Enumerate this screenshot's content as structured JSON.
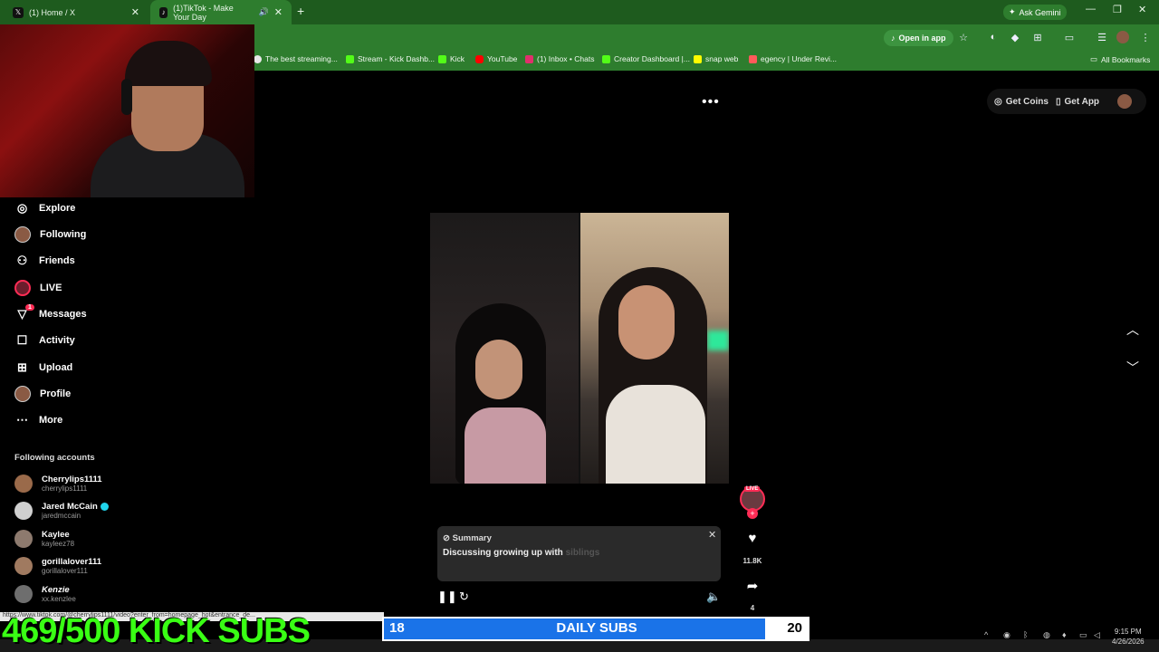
{
  "browser": {
    "tabs": [
      {
        "label": "(1) Home / X",
        "icon": "x-icon"
      },
      {
        "label": "(1)TikTok - Make Your Day",
        "icon": "tiktok-icon"
      }
    ],
    "ask_gemini": "Ask Gemini",
    "open_in_app": "Open in app",
    "bookmarks": [
      {
        "label": "The best streaming...",
        "color": "#e8e8e8"
      },
      {
        "label": "Stream - Kick Dashb...",
        "color": "#53fc18"
      },
      {
        "label": "Kick",
        "color": "#53fc18"
      },
      {
        "label": "YouTube",
        "color": "#ff0000"
      },
      {
        "label": "(1) Inbox • Chats",
        "color": "#e1306c"
      },
      {
        "label": "Creator Dashboard |...",
        "color": "#53fc18"
      },
      {
        "label": "snap web",
        "color": "#fffc00"
      },
      {
        "label": "egency | Under Revi...",
        "color": "#ff5a5a"
      }
    ],
    "all_bookmarks": "All Bookmarks"
  },
  "sidebar": {
    "nav": [
      {
        "label": "Explore",
        "icon": "compass-icon"
      },
      {
        "label": "Following",
        "icon": "following-avatar-icon"
      },
      {
        "label": "Friends",
        "icon": "friends-icon"
      },
      {
        "label": "LIVE",
        "icon": "live-icon"
      },
      {
        "label": "Messages",
        "icon": "messages-icon",
        "badge": "1"
      },
      {
        "label": "Activity",
        "icon": "activity-icon"
      },
      {
        "label": "Upload",
        "icon": "upload-icon"
      },
      {
        "label": "Profile",
        "icon": "profile-avatar-icon"
      },
      {
        "label": "More",
        "icon": "more-icon"
      }
    ],
    "following_label": "Following accounts",
    "accounts": [
      {
        "name": "Cherrylips1111",
        "username": "cherrylips1111",
        "verified": false
      },
      {
        "name": "Jared McCain",
        "username": "jaredmccain",
        "verified": true
      },
      {
        "name": "Kaylee",
        "username": "kayleez78",
        "verified": false
      },
      {
        "name": "gorillalover111",
        "username": "gorillalover111",
        "verified": false
      },
      {
        "name": "Kenzie",
        "username": "xx.kenzlee",
        "verified": false
      }
    ]
  },
  "header": {
    "get_coins": "Get Coins",
    "get_app": "Get App"
  },
  "rail": {
    "live_tag": "LIVE",
    "likes": "11.8K",
    "shares": "4"
  },
  "summary": {
    "title": "Summary",
    "text": "Discussing growing up with",
    "text_fade": "siblings"
  },
  "stream_overlay": {
    "status_url": "https://www.tiktok.com/@cherrylips1111/video?enter_from=homepage_hot&entrance_de...",
    "kick_subs": "469/500 KICK SUBS",
    "daily_current": "18",
    "daily_label": "DAILY SUBS",
    "daily_goal": "20",
    "daily_progress": 0.9
  },
  "clock": {
    "time": "9:15 PM",
    "date": "4/26/2026"
  },
  "colors": {
    "browser_green": "#2e7d2e",
    "tiktok_red": "#fe2c55",
    "kick_green": "#39ff14",
    "progress_blue": "#1a73e8"
  }
}
